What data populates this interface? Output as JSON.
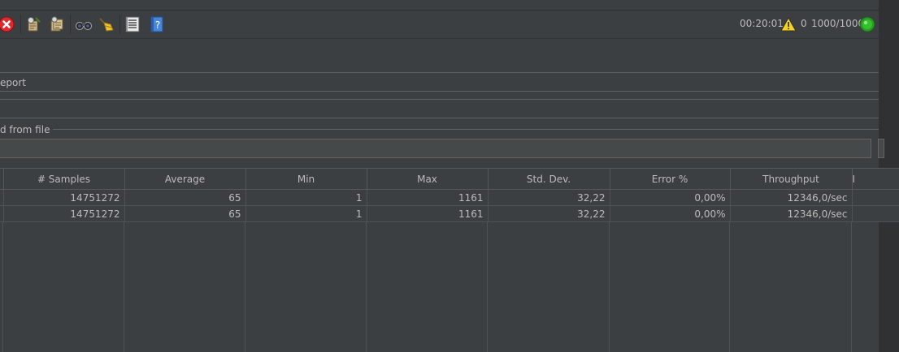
{
  "status": {
    "elapsed": "00:20:01",
    "warnings": "0",
    "threads": "1000/1000",
    "running_color": "#33c12d"
  },
  "toolbar": {
    "icons": [
      "stop-now-icon",
      "clear-icon",
      "clear-all-icon",
      "search-icon",
      "reset-search-icon",
      "function-helper-icon",
      "help-icon"
    ]
  },
  "panel": {
    "report_label": "eport",
    "file_label": "d from file"
  },
  "table": {
    "columns": [
      "# Samples",
      "Average",
      "Min",
      "Max",
      "Std. Dev.",
      "Error %",
      "Throughput",
      "I"
    ],
    "rows": [
      [
        "14751272",
        "65",
        "1",
        "1161",
        "32,22",
        "0,00%",
        "12346,0/sec"
      ],
      [
        "14751272",
        "65",
        "1",
        "1161",
        "32,22",
        "0,00%",
        "12346,0/sec"
      ]
    ]
  }
}
